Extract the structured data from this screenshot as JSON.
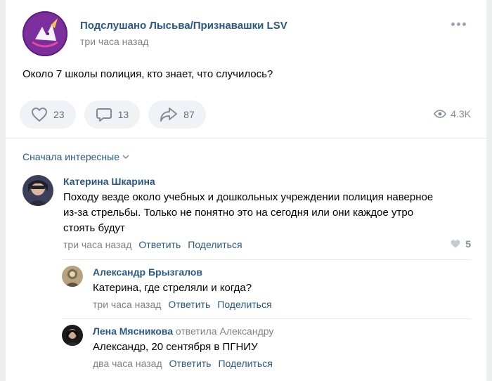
{
  "post": {
    "group_name": "Подслушано Лысьва/Признавашки LSV",
    "time": "три часа назад",
    "text": "Около 7 школы полиция, кто знает, что случилось?",
    "likes": "23",
    "comments": "13",
    "shares": "87",
    "views": "4.3K",
    "more_icon": "more-horizontal-icon"
  },
  "sort_label": "Сначала интересные",
  "comments": [
    {
      "author": "Катерина Шкарина",
      "text_lines": [
        "Походу везде около учебных и дошкольных учреждении полиция наверное",
        "из-за стрельбы. Только не понятно это на сегодня или они каждое утро",
        "стоять будут"
      ],
      "time": "три часа назад",
      "reply": "Ответить",
      "share": "Поделиться",
      "likes": "5"
    }
  ],
  "replies": [
    {
      "author": "Александр Брызгалов",
      "replied_to": "",
      "text": "Катерина, где стреляли и когда?",
      "time": "три часа назад",
      "reply": "Ответить",
      "share": "Поделиться"
    },
    {
      "author": "Лена Мясникова",
      "replied_to": "ответила Александру",
      "text": "Александр, 20 сентября в ПГНИУ",
      "time": "два часа назад",
      "reply": "Ответить",
      "share": "Поделиться"
    }
  ],
  "colors": {
    "link": "#2a5885",
    "meta": "#828282",
    "pill_bg": "#f0f2f5",
    "icon": "#818c99"
  }
}
